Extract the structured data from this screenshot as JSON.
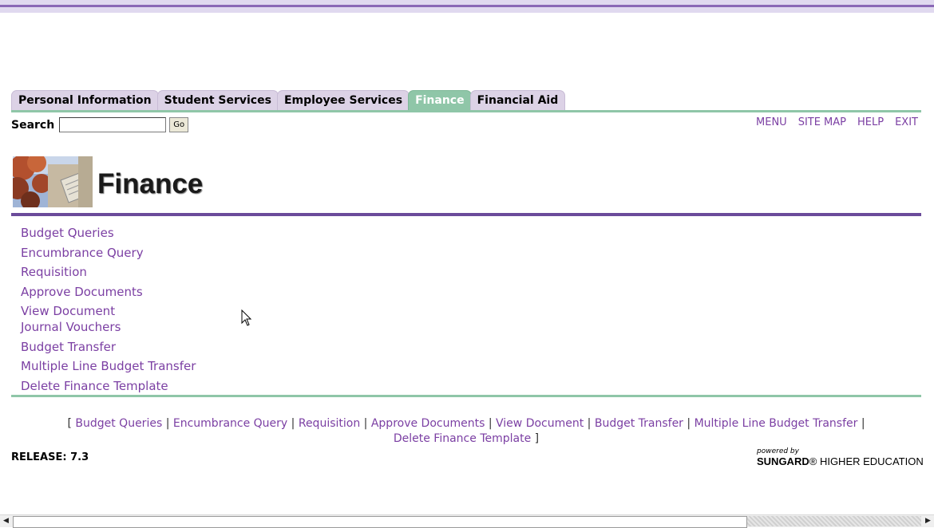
{
  "tabs": [
    {
      "label": "Personal Information",
      "active": false
    },
    {
      "label": "Student Services",
      "active": false
    },
    {
      "label": "Employee Services",
      "active": false
    },
    {
      "label": "Finance",
      "active": true
    },
    {
      "label": "Financial Aid",
      "active": false
    }
  ],
  "search": {
    "label": "Search",
    "value": "",
    "button": "Go"
  },
  "top_links": [
    "MENU",
    "SITE MAP",
    "HELP",
    "EXIT"
  ],
  "page": {
    "title": "Finance"
  },
  "menu": [
    "Budget Queries",
    "Encumbrance Query",
    "Requisition",
    "Approve Documents",
    "View Document",
    "Journal Vouchers",
    "Budget Transfer",
    "Multiple Line Budget Transfer",
    "Delete Finance Template"
  ],
  "bottom_nav": {
    "open": "[",
    "close": "]",
    "separator": "|",
    "links": [
      "Budget Queries",
      "Encumbrance Query",
      "Requisition",
      "Approve Documents",
      "View Document",
      "Budget Transfer",
      "Multiple Line Budget Transfer",
      "Delete Finance Template"
    ]
  },
  "footer": {
    "release": "RELEASE: 7.3",
    "powered_by": "powered by",
    "brand_bold": "SUNGARD",
    "brand_rest": "HIGHER EDUCATION"
  },
  "colors": {
    "link": "#7b3fa3",
    "active_tab": "#8fc6a8",
    "tab": "#dcd2e6",
    "rule_purple": "#6b4b9a",
    "rule_green": "#8fc6a8"
  }
}
